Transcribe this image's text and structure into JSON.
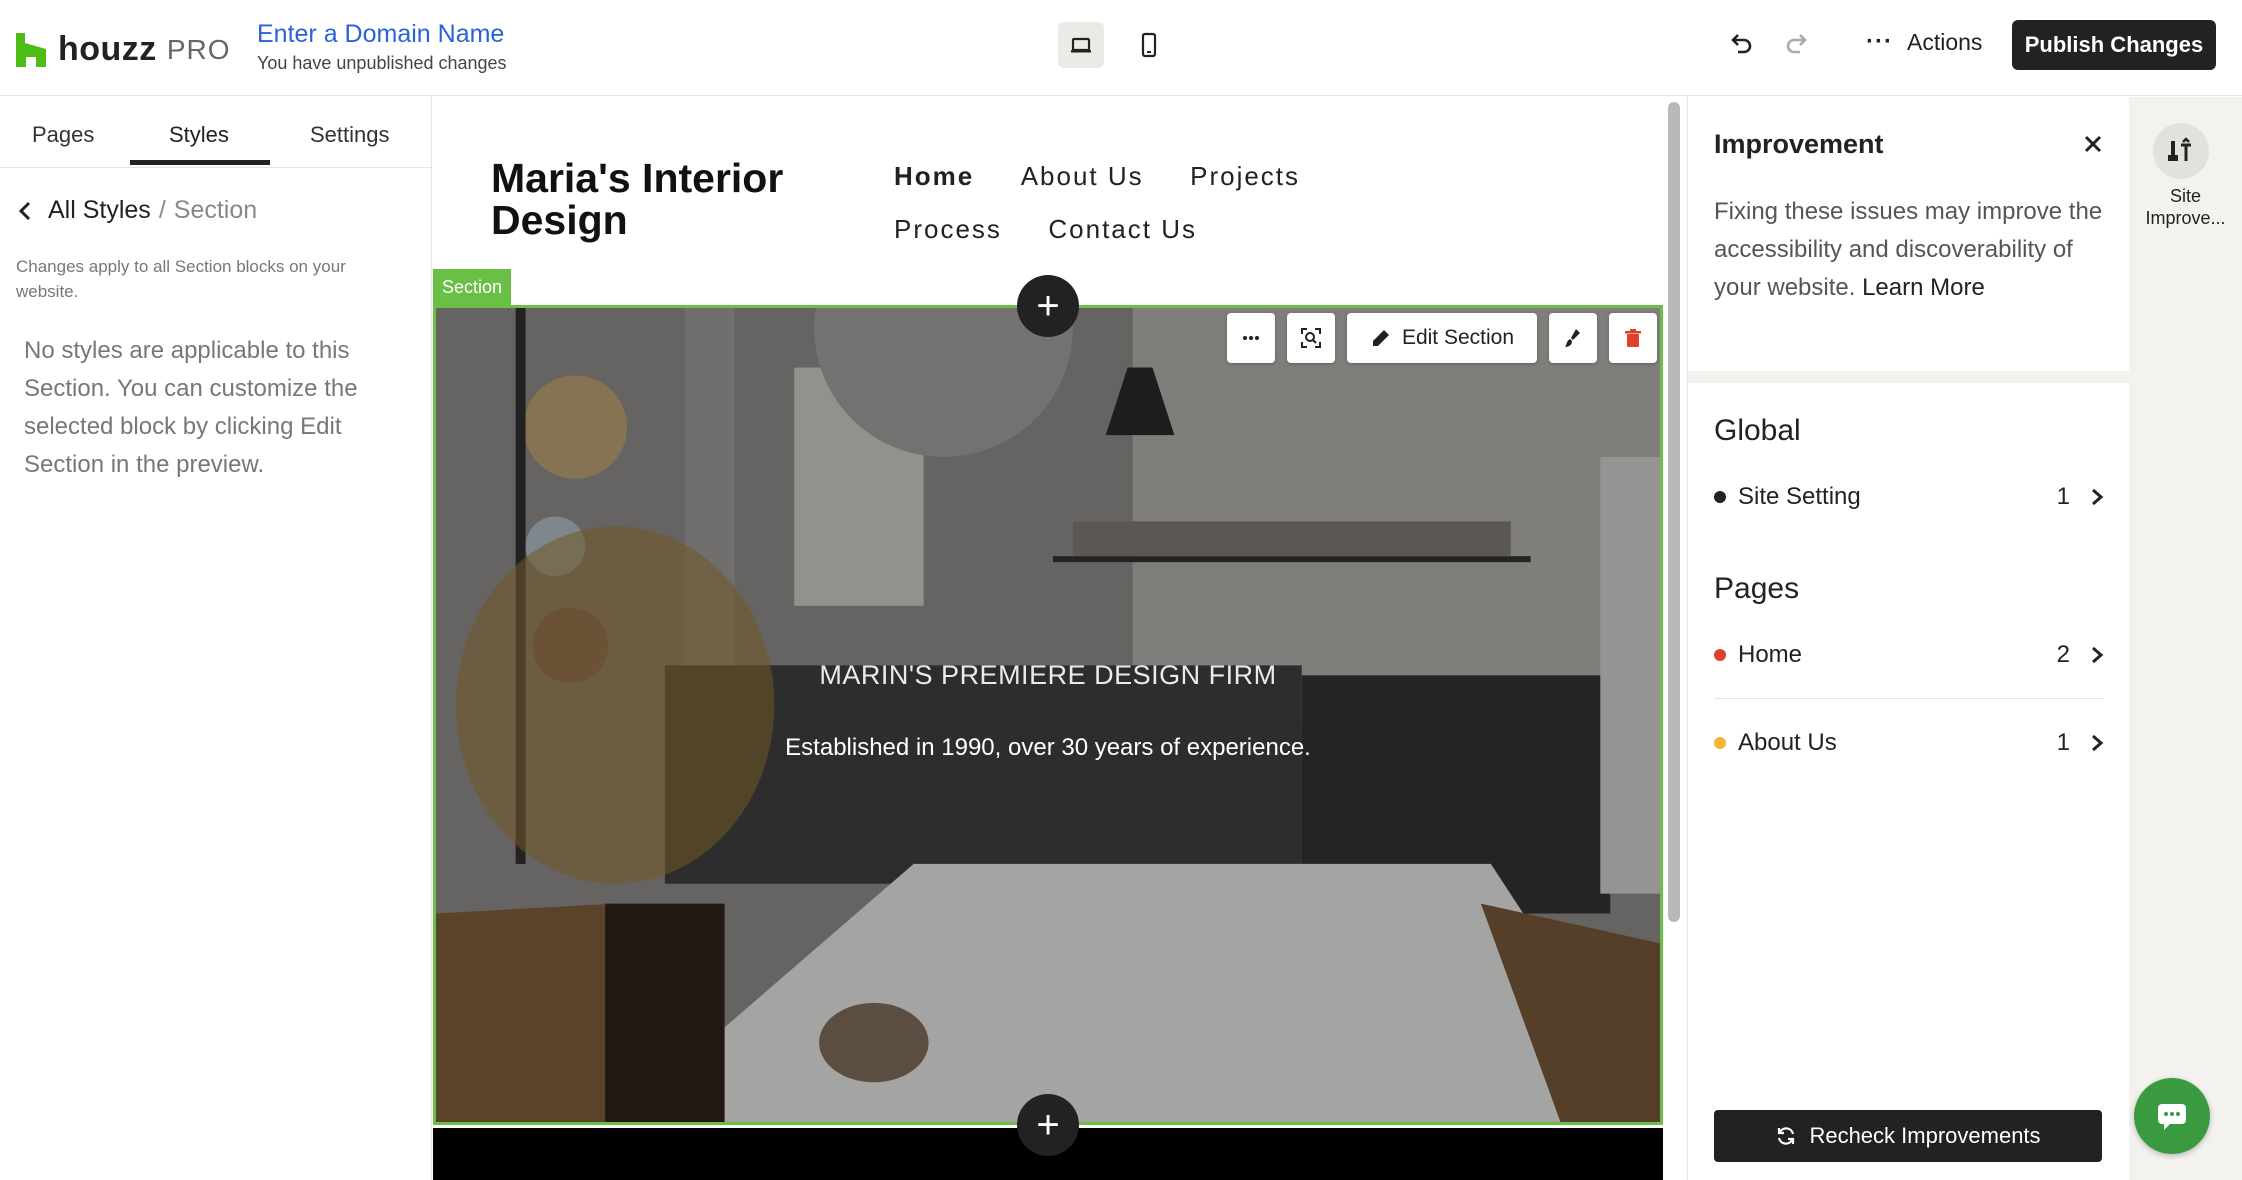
{
  "brand": {
    "name": "houzz",
    "tier": "PRO",
    "color": "#4dbc15"
  },
  "header": {
    "domain_link": "Enter a Domain Name",
    "domain_status": "You have unpublished changes",
    "actions_label": "Actions",
    "publish_label": "Publish Changes"
  },
  "left_panel": {
    "tabs": [
      "Pages",
      "Styles",
      "Settings"
    ],
    "active_tab": "Styles",
    "breadcrumb": {
      "root": "All Styles",
      "separator": "/",
      "current": "Section"
    },
    "note": "Changes apply to all Section blocks on your website.",
    "message": "No styles are applicable to this Section. You can customize the selected block by clicking Edit Section in the preview."
  },
  "preview": {
    "site_title": "Maria's Interior Design",
    "nav": [
      "Home",
      "About Us",
      "Projects",
      "Process",
      "Contact Us"
    ],
    "active_nav": "Home",
    "section_tag": "Section",
    "hero_heading": "MARIN'S PREMIERE DESIGN FIRM",
    "hero_subheading": "Established in 1990, over 30 years of experience.",
    "edit_section_label": "Edit Section",
    "selection_color": "#6ac046"
  },
  "improvement": {
    "title": "Improvement",
    "description": "Fixing these issues may improve the accessibility and discoverability of your website.",
    "learn_more": "Learn More",
    "groups": [
      {
        "title": "Global",
        "items": [
          {
            "label": "Site Setting",
            "count": "1",
            "color": "#222222"
          }
        ]
      },
      {
        "title": "Pages",
        "items": [
          {
            "label": "Home",
            "count": "2",
            "color": "#e0412f"
          },
          {
            "label": "About Us",
            "count": "1",
            "color": "#f2b632"
          }
        ]
      }
    ],
    "recheck_label": "Recheck Improvements"
  },
  "rail": {
    "label": "Site Improve..."
  }
}
